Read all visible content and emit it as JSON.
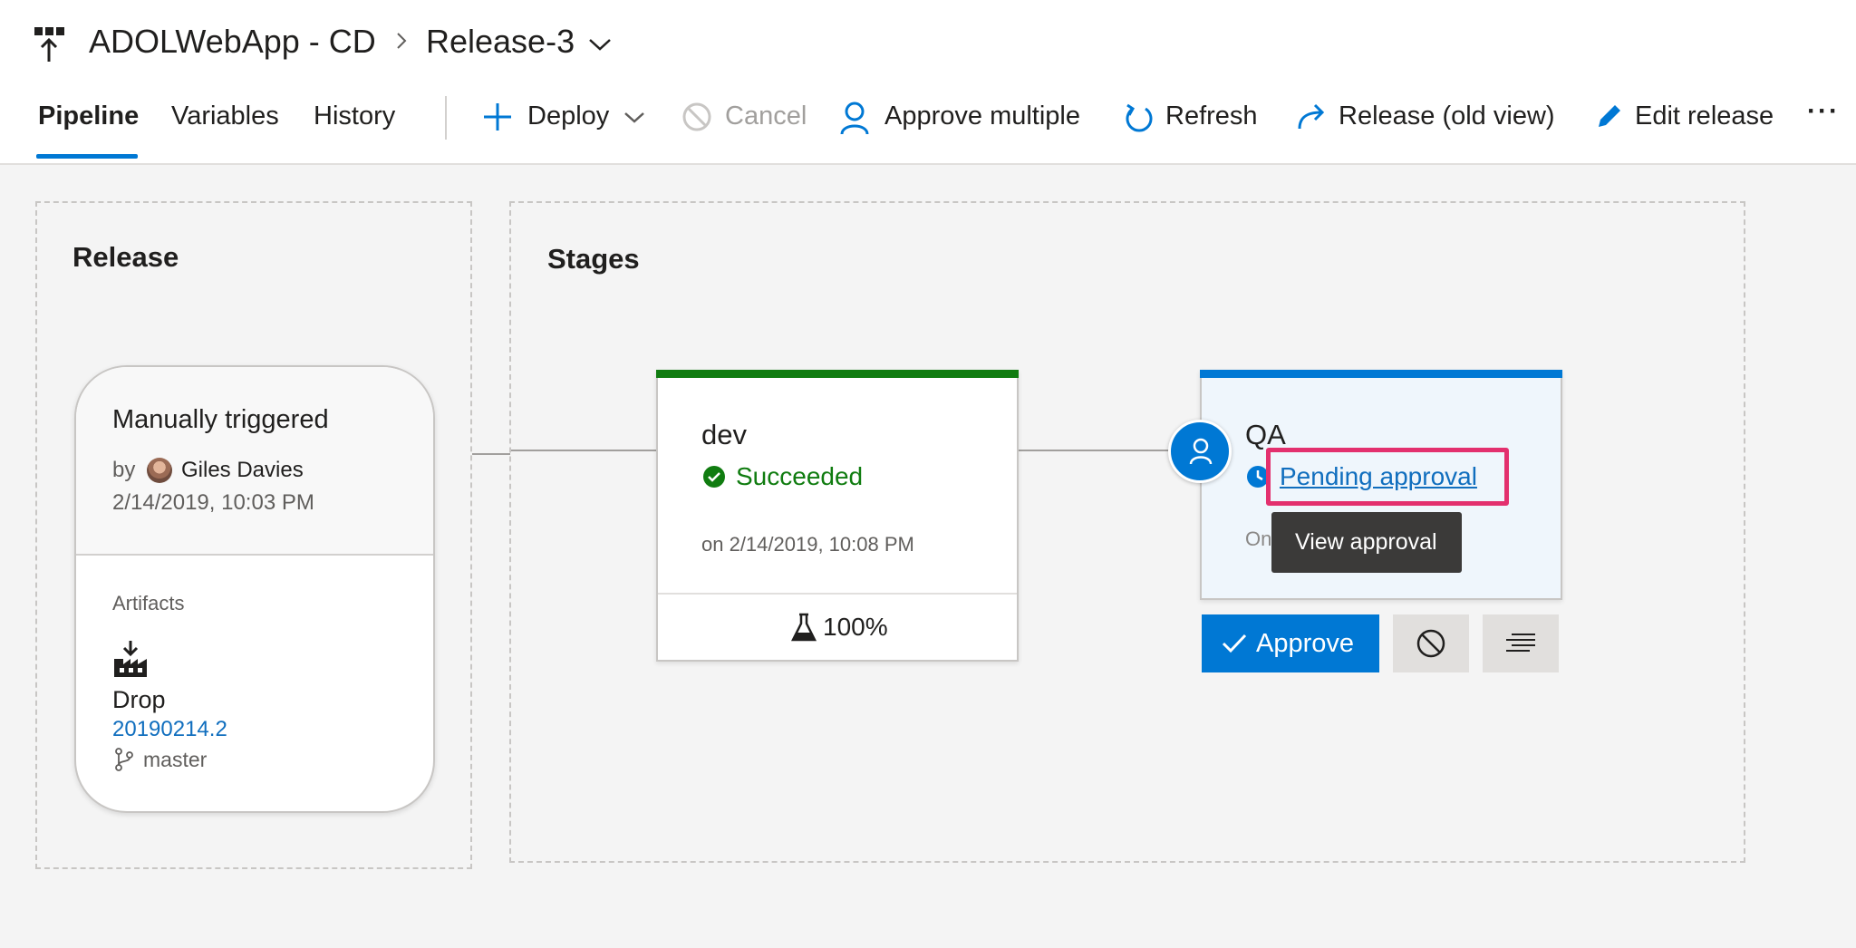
{
  "header": {
    "pipeline_name": "ADOLWebApp - CD",
    "release_name": "Release-3"
  },
  "tabs": [
    {
      "label": "Pipeline",
      "active": true
    },
    {
      "label": "Variables",
      "active": false
    },
    {
      "label": "History",
      "active": false
    }
  ],
  "toolbar": {
    "deploy": "Deploy",
    "cancel": "Cancel",
    "approve_multiple": "Approve multiple",
    "refresh": "Refresh",
    "release_old_view": "Release (old view)",
    "edit_release": "Edit release",
    "more": "···"
  },
  "release_section": {
    "title": "Release",
    "trigger": "Manually triggered",
    "by_label": "by",
    "user": "Giles Davies",
    "date": "2/14/2019, 10:03 PM",
    "artifacts_label": "Artifacts",
    "artifact_name": "Drop",
    "artifact_version": "20190214.2",
    "branch": "master"
  },
  "stages_section": {
    "title": "Stages",
    "dev": {
      "name": "dev",
      "status": "Succeeded",
      "date": "on 2/14/2019, 10:08 PM",
      "tests": "100%",
      "status_color": "#107c10"
    },
    "qa": {
      "name": "QA",
      "status": "Pending approval",
      "date_prefix": "On",
      "tooltip": "View approval",
      "status_color": "#0078d4",
      "approve_label": "Approve"
    }
  },
  "colors": {
    "accent": "#0078d4",
    "success": "#107c10",
    "highlight": "#e3306e"
  }
}
